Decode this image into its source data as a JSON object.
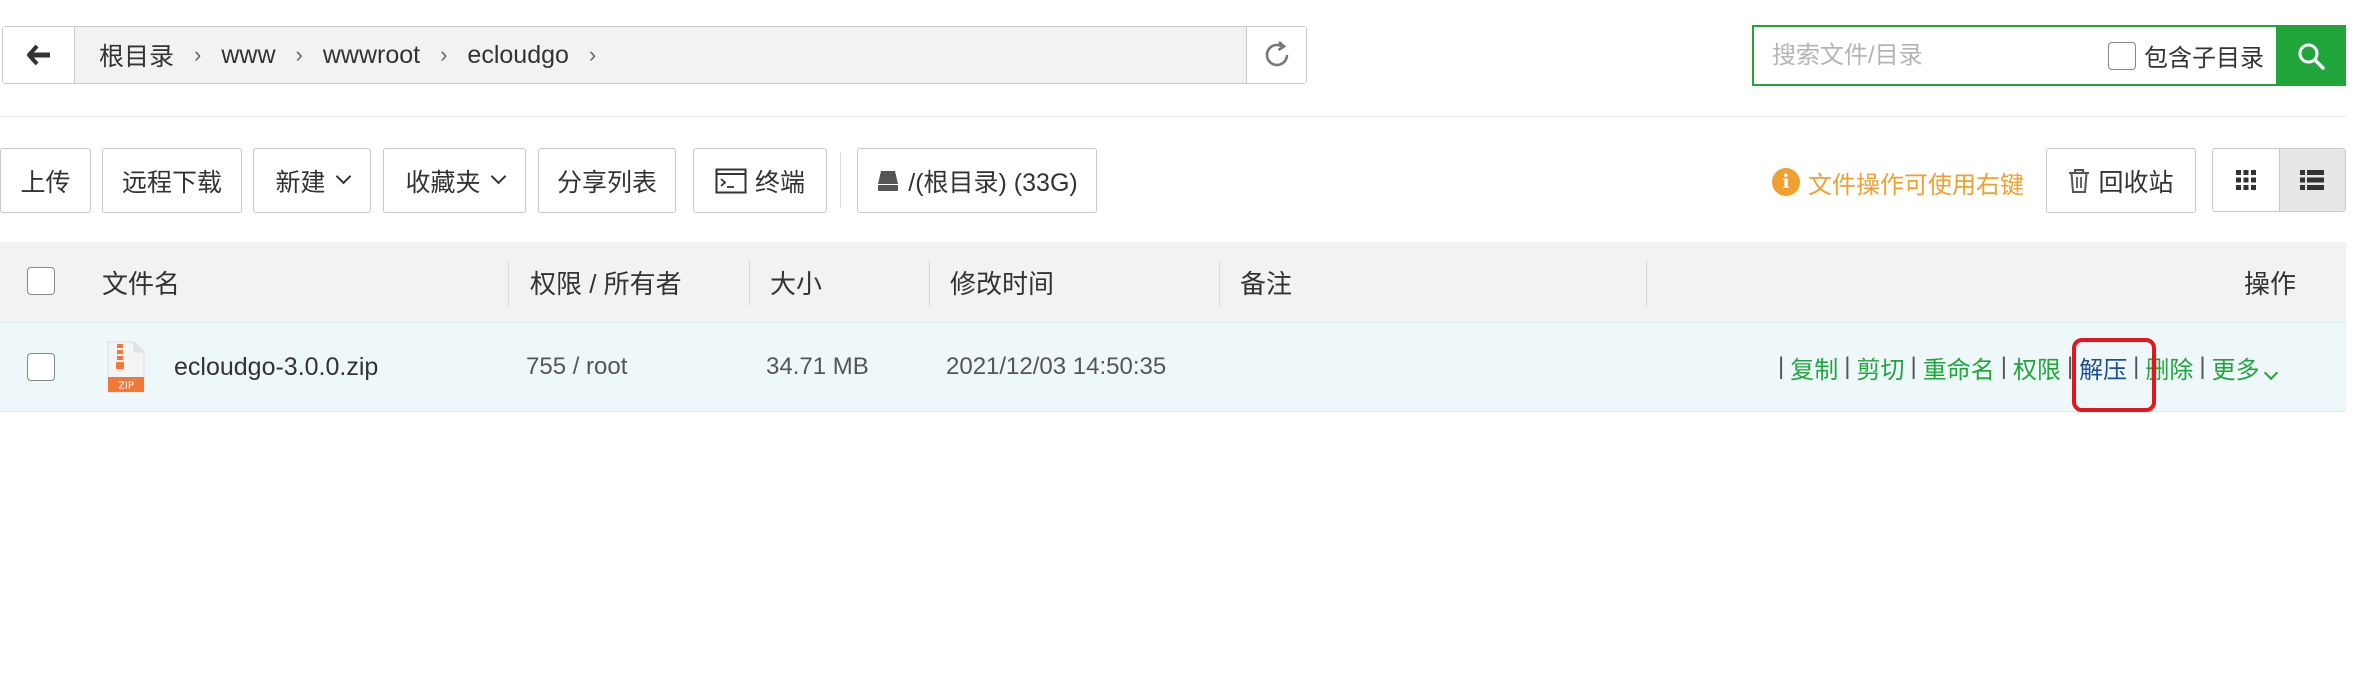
{
  "path": {
    "crumbs": [
      "根目录",
      "www",
      "wwwroot",
      "ecloudgo"
    ]
  },
  "search": {
    "placeholder": "搜索文件/目录",
    "include_subdir_label": "包含子目录"
  },
  "toolbar": {
    "upload": "上传",
    "remote_download": "远程下载",
    "new": "新建",
    "favorites": "收藏夹",
    "share_list": "分享列表",
    "terminal": "终端",
    "disk": "/(根目录) (33G)",
    "tip": "文件操作可使用右键",
    "recycle_bin": "回收站"
  },
  "table": {
    "headers": {
      "name": "文件名",
      "perm_owner": "权限 / 所有者",
      "size": "大小",
      "mtime": "修改时间",
      "note": "备注",
      "actions": "操作"
    },
    "rows": [
      {
        "name": "ecloudgo-3.0.0.zip",
        "icon_label": "ZIP",
        "perm_owner": "755 / root",
        "size": "34.71 MB",
        "mtime": "2021/12/03 14:50:35",
        "note": "",
        "actions": [
          "复制",
          "剪切",
          "重命名",
          "权限",
          "解压",
          "删除",
          "更多"
        ]
      }
    ]
  },
  "colors": {
    "accent_green": "#20a53a",
    "tip_orange": "#f0a030",
    "highlight_red": "#e8141c",
    "highlight_link": "#1e4d9a"
  },
  "highlighted_action": "解压"
}
